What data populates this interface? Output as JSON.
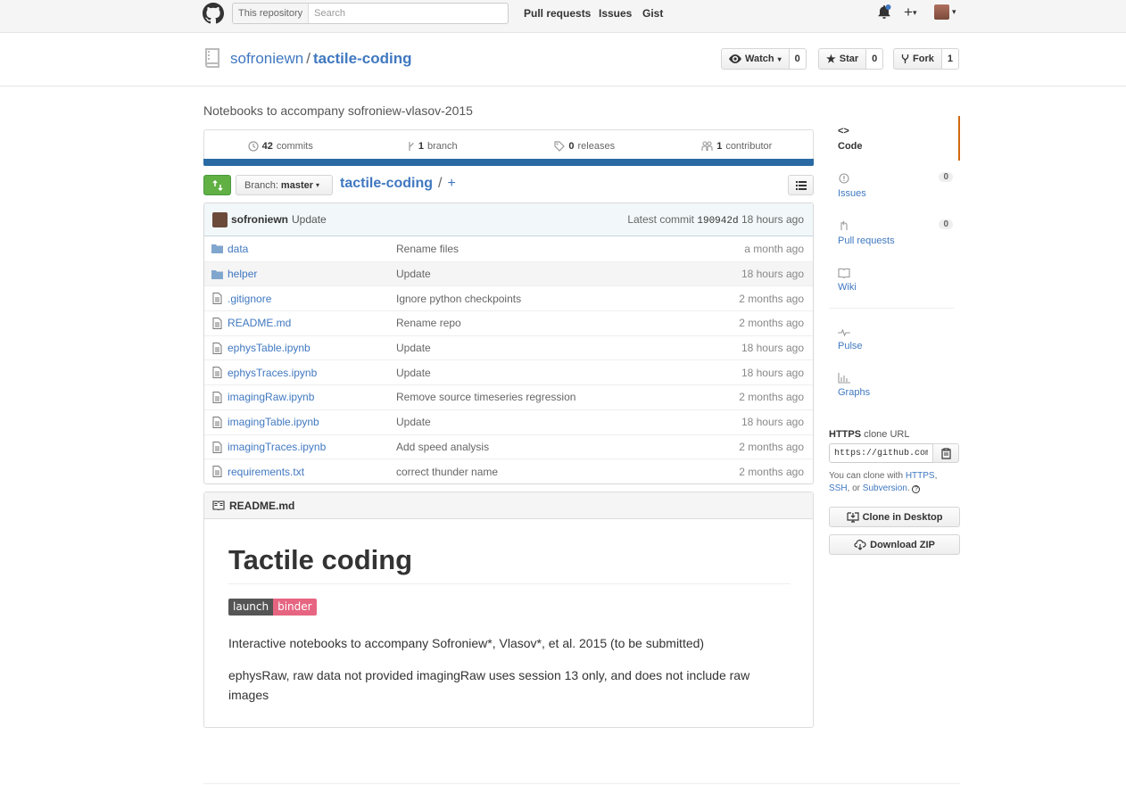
{
  "header": {
    "search_scope": "This repository",
    "search_placeholder": "Search",
    "nav": [
      "Pull requests",
      "Issues",
      "Gist"
    ]
  },
  "repo": {
    "owner": "sofroniewn",
    "separator": "/",
    "name": "tactile-coding",
    "watch_label": "Watch",
    "watch_count": "0",
    "star_label": "Star",
    "star_count": "0",
    "fork_label": "Fork",
    "fork_count": "1",
    "description": "Notebooks to accompany sofroniew-vlasov-2015"
  },
  "summary": {
    "commits_num": "42",
    "commits_label": "commits",
    "branch_num": "1",
    "branch_label": "branch",
    "releases_num": "0",
    "releases_label": "releases",
    "contributor_num": "1",
    "contributor_label": "contributor",
    "language_color": "#2a6aa4"
  },
  "filenav": {
    "branch_prefix": "Branch:",
    "branch_name": "master",
    "path_root": "tactile-coding",
    "path_sep": "/",
    "add": "+"
  },
  "commit": {
    "author": "sofroniewn",
    "message": "Update",
    "latest_label": "Latest commit",
    "sha": "190942d",
    "age": "18 hours ago"
  },
  "files": [
    {
      "type": "dir",
      "name": "data",
      "message": "Rename files",
      "age": "a month ago"
    },
    {
      "type": "dir",
      "name": "helper",
      "message": "Update",
      "age": "18 hours ago"
    },
    {
      "type": "file",
      "name": ".gitignore",
      "message": "Ignore python checkpoints",
      "age": "2 months ago"
    },
    {
      "type": "file",
      "name": "README.md",
      "message": "Rename repo",
      "age": "2 months ago"
    },
    {
      "type": "file",
      "name": "ephysTable.ipynb",
      "message": "Update",
      "age": "18 hours ago"
    },
    {
      "type": "file",
      "name": "ephysTraces.ipynb",
      "message": "Update",
      "age": "18 hours ago"
    },
    {
      "type": "file",
      "name": "imagingRaw.ipynb",
      "message": "Remove source timeseries regression",
      "age": "2 months ago"
    },
    {
      "type": "file",
      "name": "imagingTable.ipynb",
      "message": "Update",
      "age": "18 hours ago"
    },
    {
      "type": "file",
      "name": "imagingTraces.ipynb",
      "message": "Add speed analysis",
      "age": "2 months ago"
    },
    {
      "type": "file",
      "name": "requirements.txt",
      "message": "correct thunder name",
      "age": "2 months ago"
    }
  ],
  "readme": {
    "filename": "README.md",
    "title": "Tactile coding",
    "badge_left": "launch",
    "badge_right": "binder",
    "para1": "Interactive notebooks to accompany Sofroniew*, Vlasov*, et al. 2015 (to be submitted)",
    "para2": "ephysRaw, raw data not provided imagingRaw uses session 13 only, and does not include raw images"
  },
  "sidebar": {
    "code": "Code",
    "issues": "Issues",
    "issues_count": "0",
    "pulls": "Pull requests",
    "pulls_count": "0",
    "wiki": "Wiki",
    "pulse": "Pulse",
    "graphs": "Graphs",
    "clone_proto": "HTTPS",
    "clone_label": "clone URL",
    "clone_url": "https://github.com/sofroniewn/tactile-coding.git",
    "help_prefix": "You can clone with ",
    "help_https": "HTTPS",
    "help_comma": ",",
    "help_ssh": "SSH",
    "help_or": ", or ",
    "help_svn": "Subversion",
    "help_end": ".",
    "clone_desktop": "Clone in Desktop",
    "download_zip": "Download ZIP"
  }
}
